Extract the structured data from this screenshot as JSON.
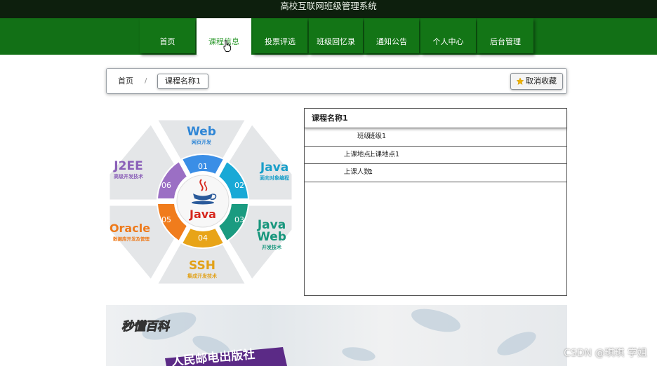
{
  "app": {
    "title": "高校互联网班级管理系统"
  },
  "nav": {
    "items": [
      {
        "label": "首页"
      },
      {
        "label": "课程信息"
      },
      {
        "label": "投票评选"
      },
      {
        "label": "班级回忆录"
      },
      {
        "label": "通知公告"
      },
      {
        "label": "个人中心"
      },
      {
        "label": "后台管理"
      }
    ],
    "active_index": 1
  },
  "breadcrumb": {
    "home": "首页",
    "separator": "/",
    "current": "课程名称1"
  },
  "favorite_button": {
    "label": "取消收藏",
    "icon": "star-icon"
  },
  "course_image": {
    "center_logo": "Java",
    "segments": [
      {
        "num": "01",
        "color": "#3a8ee6"
      },
      {
        "num": "02",
        "color": "#19a9d6"
      },
      {
        "num": "03",
        "color": "#1a9b80"
      },
      {
        "num": "04",
        "color": "#e8a418"
      },
      {
        "num": "05",
        "color": "#f07c1c"
      },
      {
        "num": "06",
        "color": "#9b6fc4"
      }
    ],
    "labels": [
      {
        "title": "Web",
        "sub": "网页开发",
        "color": "#2f86d6"
      },
      {
        "title": "Java",
        "sub": "面向对象编程",
        "color": "#1a9fc9"
      },
      {
        "title": "Java",
        "title2": "Web",
        "sub": "开发技术",
        "color": "#17967c"
      },
      {
        "title": "SSH",
        "sub": "集成开发技术",
        "color": "#e2a118"
      },
      {
        "title": "Oracle",
        "sub": "数据库开发及管理",
        "color": "#ee7a1b"
      },
      {
        "title": "J2EE",
        "sub": "高级开发技术",
        "color": "#8a5fb8"
      }
    ]
  },
  "course_info": {
    "title": "课程名称1",
    "rows": [
      {
        "key": "班级:",
        "value": "班级1"
      },
      {
        "key": "上课地点:",
        "value": "上课地点1"
      },
      {
        "key": "上课人数:",
        "value": "1"
      }
    ]
  },
  "banner": {
    "logo": "秒懂百科",
    "publisher": "人民邮电出版社"
  },
  "watermark": "CSDN @琪琪 学姐"
}
